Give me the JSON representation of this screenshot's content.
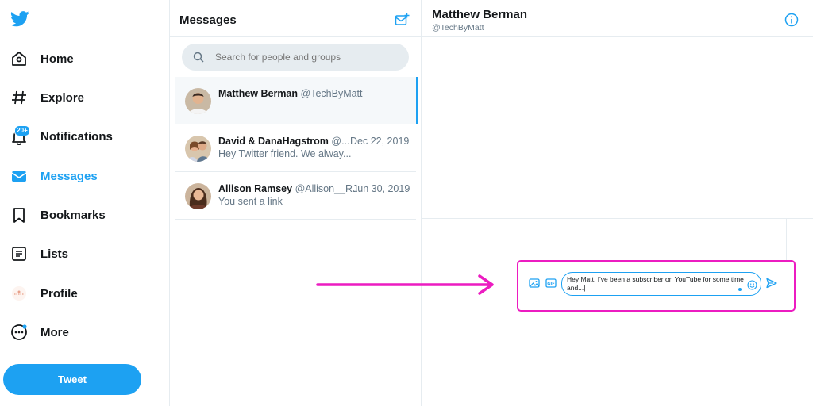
{
  "nav": {
    "items": [
      {
        "label": "Home",
        "icon": "home-icon"
      },
      {
        "label": "Explore",
        "icon": "hashtag-icon"
      },
      {
        "label": "Notifications",
        "icon": "bell-icon",
        "badge": "20+"
      },
      {
        "label": "Messages",
        "icon": "envelope-icon",
        "active": true
      },
      {
        "label": "Bookmarks",
        "icon": "bookmark-icon"
      },
      {
        "label": "Lists",
        "icon": "list-icon"
      },
      {
        "label": "Profile",
        "icon": "profile-avatar-icon"
      },
      {
        "label": "More",
        "icon": "more-icon"
      }
    ],
    "tweet_label": "Tweet"
  },
  "messages": {
    "title": "Messages",
    "search_placeholder": "Search for people and groups",
    "conversations": [
      {
        "name": "Matthew Berman",
        "handle": "@TechByMatt",
        "date": "",
        "preview": ""
      },
      {
        "name": "David & DanaHagstrom",
        "handle": "@...",
        "date": "Dec 22, 2019",
        "preview": "Hey Twitter friend. We alway..."
      },
      {
        "name": "Allison Ramsey",
        "handle": "@Allison__R...",
        "date": "Jun 30, 2019",
        "preview": "You sent a link"
      }
    ]
  },
  "chat": {
    "name": "Matthew Berman",
    "handle": "@TechByMatt",
    "composer_text": "Hey Matt, I've been a subscriber on YouTube for some time and...|"
  },
  "colors": {
    "accent": "#1da1f2",
    "highlight": "#ec1cc1"
  }
}
